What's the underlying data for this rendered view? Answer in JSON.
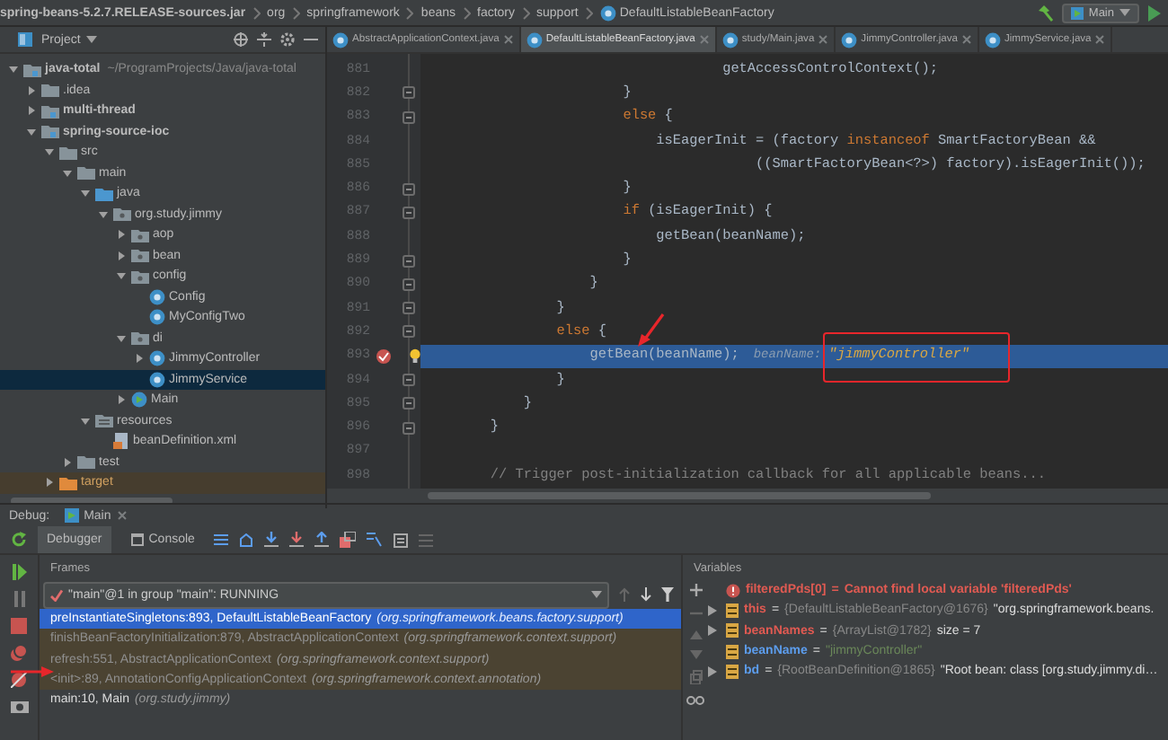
{
  "breadcrumb": [
    {
      "label": "spring-beans-5.2.7.RELEASE-sources.jar",
      "kind": "jar"
    },
    {
      "label": "org",
      "kind": "package"
    },
    {
      "label": "springframework",
      "kind": "package"
    },
    {
      "label": "beans",
      "kind": "package"
    },
    {
      "label": "factory",
      "kind": "package"
    },
    {
      "label": "support",
      "kind": "package"
    },
    {
      "label": "DefaultListableBeanFactory",
      "kind": "class"
    }
  ],
  "run_config": {
    "label": "Main"
  },
  "project": {
    "title": "Project",
    "tree": [
      {
        "label": "java-total",
        "path": "~/ProgramProjects/Java/java-total",
        "kind": "module",
        "expanded": true,
        "selected": false,
        "children": [
          {
            "label": ".idea",
            "kind": "folder",
            "expanded": false,
            "selected": false
          },
          {
            "label": "multi-thread",
            "kind": "module",
            "expanded": false,
            "selected": false
          },
          {
            "label": "spring-source-ioc",
            "kind": "module",
            "expanded": true,
            "selected": false,
            "children": [
              {
                "label": "src",
                "kind": "folder",
                "expanded": true,
                "selected": false,
                "children": [
                  {
                    "label": "main",
                    "kind": "folder",
                    "expanded": true,
                    "selected": false,
                    "children": [
                      {
                        "label": "java",
                        "kind": "source-folder",
                        "expanded": true,
                        "selected": false,
                        "children": [
                          {
                            "label": "org.study.jimmy",
                            "kind": "package",
                            "expanded": true,
                            "selected": false,
                            "children": [
                              {
                                "label": "aop",
                                "kind": "package",
                                "expanded": false,
                                "selected": false
                              },
                              {
                                "label": "bean",
                                "kind": "package",
                                "expanded": false,
                                "selected": false
                              },
                              {
                                "label": "config",
                                "kind": "package",
                                "expanded": true,
                                "selected": false,
                                "children": [
                                  {
                                    "label": "Config",
                                    "kind": "class",
                                    "selected": false
                                  },
                                  {
                                    "label": "MyConfigTwo",
                                    "kind": "class",
                                    "selected": false
                                  }
                                ]
                              },
                              {
                                "label": "di",
                                "kind": "package",
                                "expanded": true,
                                "selected": false,
                                "children": [
                                  {
                                    "label": "JimmyController",
                                    "kind": "class",
                                    "expanded": false,
                                    "selected": false
                                  },
                                  {
                                    "label": "JimmyService",
                                    "kind": "class",
                                    "selected": true
                                  }
                                ]
                              },
                              {
                                "label": "Main",
                                "kind": "main-class",
                                "expanded": false,
                                "selected": false
                              }
                            ]
                          }
                        ]
                      },
                      {
                        "label": "resources",
                        "kind": "resources",
                        "expanded": true,
                        "selected": false,
                        "children": [
                          {
                            "label": "beanDefinition.xml",
                            "kind": "xml",
                            "selected": false
                          }
                        ]
                      }
                    ]
                  },
                  {
                    "label": "test",
                    "kind": "folder",
                    "expanded": false,
                    "selected": false
                  }
                ]
              },
              {
                "label": "target",
                "kind": "excluded",
                "expanded": false,
                "selected": false
              }
            ]
          }
        ]
      }
    ]
  },
  "tabs": [
    {
      "label": "AbstractApplicationContext.java",
      "selected": false
    },
    {
      "label": "DefaultListableBeanFactory.java",
      "selected": true
    },
    {
      "label": "study/Main.java",
      "selected": false
    },
    {
      "label": "JimmyController.java",
      "selected": false
    },
    {
      "label": "JimmyService.java",
      "selected": false
    }
  ],
  "editor": {
    "lines": [
      {
        "number": "881",
        "fold": false,
        "breakpoint": false,
        "current": false,
        "tokens": [
          {
            "kind": "plain",
            "text": "                                    getAccessControlContext();"
          }
        ]
      },
      {
        "number": "882",
        "fold": true,
        "breakpoint": false,
        "current": false,
        "tokens": [
          {
            "kind": "plain",
            "text": "                        }"
          }
        ]
      },
      {
        "number": "883",
        "fold": true,
        "breakpoint": false,
        "current": false,
        "tokens": [
          {
            "kind": "keyword",
            "text": "                        else"
          },
          {
            "kind": "plain",
            "text": " {"
          }
        ]
      },
      {
        "number": "884",
        "fold": false,
        "breakpoint": false,
        "current": false,
        "tokens": [
          {
            "kind": "plain",
            "text": "                            isEagerInit = (factory "
          },
          {
            "kind": "keyword",
            "text": "instanceof"
          },
          {
            "kind": "plain",
            "text": " SmartFactoryBean &&"
          }
        ]
      },
      {
        "number": "885",
        "fold": false,
        "breakpoint": false,
        "current": false,
        "tokens": [
          {
            "kind": "plain",
            "text": "                                        ((SmartFactoryBean<?>) factory).isEagerInit());"
          }
        ]
      },
      {
        "number": "886",
        "fold": true,
        "breakpoint": false,
        "current": false,
        "tokens": [
          {
            "kind": "plain",
            "text": "                        }"
          }
        ]
      },
      {
        "number": "887",
        "fold": true,
        "breakpoint": false,
        "current": false,
        "tokens": [
          {
            "kind": "keyword",
            "text": "                        if"
          },
          {
            "kind": "plain",
            "text": " (isEagerInit) {"
          }
        ]
      },
      {
        "number": "888",
        "fold": false,
        "breakpoint": false,
        "current": false,
        "tokens": [
          {
            "kind": "plain",
            "text": "                            getBean(beanName);"
          }
        ]
      },
      {
        "number": "889",
        "fold": true,
        "breakpoint": false,
        "current": false,
        "tokens": [
          {
            "kind": "plain",
            "text": "                        }"
          }
        ]
      },
      {
        "number": "890",
        "fold": true,
        "breakpoint": false,
        "current": false,
        "tokens": [
          {
            "kind": "plain",
            "text": "                    }"
          }
        ]
      },
      {
        "number": "891",
        "fold": true,
        "breakpoint": false,
        "current": false,
        "tokens": [
          {
            "kind": "plain",
            "text": "                }"
          }
        ]
      },
      {
        "number": "892",
        "fold": true,
        "breakpoint": false,
        "current": false,
        "tokens": [
          {
            "kind": "keyword",
            "text": "                else"
          },
          {
            "kind": "plain",
            "text": " {"
          }
        ]
      },
      {
        "number": "893",
        "fold": false,
        "breakpoint": true,
        "current": true,
        "arrow": true,
        "tokens": [
          {
            "kind": "plain",
            "text": "                    getBean(beanName);"
          },
          {
            "kind": "hint-name",
            "text": "beanName:"
          },
          {
            "kind": "hint-value",
            "text": "\"jimmyController\"",
            "boxed": true
          }
        ]
      },
      {
        "number": "894",
        "fold": true,
        "breakpoint": false,
        "current": false,
        "tokens": [
          {
            "kind": "plain",
            "text": "                }"
          }
        ]
      },
      {
        "number": "895",
        "fold": true,
        "breakpoint": false,
        "current": false,
        "tokens": [
          {
            "kind": "plain",
            "text": "            }"
          }
        ]
      },
      {
        "number": "896",
        "fold": true,
        "breakpoint": false,
        "current": false,
        "tokens": [
          {
            "kind": "plain",
            "text": "        }"
          }
        ]
      },
      {
        "number": "897",
        "fold": false,
        "breakpoint": false,
        "current": false
      },
      {
        "number": "898",
        "fold": false,
        "breakpoint": false,
        "current": false,
        "tokens": [
          {
            "kind": "comment",
            "text": "        // Trigger post-initialization callback for all applicable beans..."
          }
        ]
      }
    ]
  },
  "debug": {
    "label": "Debug:",
    "session_tab": {
      "label": "Main"
    },
    "tabs": [
      {
        "label": "Debugger",
        "selected": true
      },
      {
        "label": "Console",
        "selected": false
      }
    ],
    "frames": {
      "title": "Frames",
      "thread": "\"main\"@1 in group \"main\": RUNNING",
      "items": [
        {
          "method": "preInstantiateSingletons:893, DefaultListableBeanFactory",
          "package": "(org.springframework.beans.factory.support)",
          "selected": true,
          "library": false,
          "arrow": false
        },
        {
          "method": "finishBeanFactoryInitialization:879, AbstractApplicationContext",
          "package": "(org.springframework.context.support)",
          "selected": false,
          "library": true,
          "arrow": false
        },
        {
          "method": "refresh:551, AbstractApplicationContext",
          "package": "(org.springframework.context.support)",
          "selected": false,
          "library": true,
          "arrow": true
        },
        {
          "method": "<init>:89, AnnotationConfigApplicationContext",
          "package": "(org.springframework.context.annotation)",
          "selected": false,
          "library": true,
          "arrow": false
        },
        {
          "method": "main:10, Main",
          "package": "(org.study.jimmy)",
          "selected": false,
          "library": false,
          "arrow": false
        }
      ]
    },
    "variables": {
      "title": "Variables",
      "items": [
        {
          "kind": "error",
          "name": "filteredPds[0]",
          "assign": "=",
          "value": "Cannot find local variable 'filteredPds'",
          "color": "#e05a52"
        },
        {
          "kind": "field",
          "expandable": true,
          "name": "this",
          "assign": "=",
          "type": "{DefaultListableBeanFactory@1676}",
          "value": "\"org.springframework.beans.",
          "color": "#e05a52"
        },
        {
          "kind": "field",
          "expandable": true,
          "name": "beanNames",
          "assign": "=",
          "type": "{ArrayList@1782}",
          "value": "size = 7",
          "color": "#e05a52"
        },
        {
          "kind": "string",
          "expandable": false,
          "name": "beanName",
          "assign": "=",
          "value": "\"jimmyController\"",
          "color": "#5c9ded"
        },
        {
          "kind": "field",
          "expandable": true,
          "name": "bd",
          "assign": "=",
          "type": "{RootBeanDefinition@1865}",
          "value": "\"Root bean: class [org.study.jimmy.di…",
          "color": "#5c9ded"
        }
      ]
    }
  }
}
